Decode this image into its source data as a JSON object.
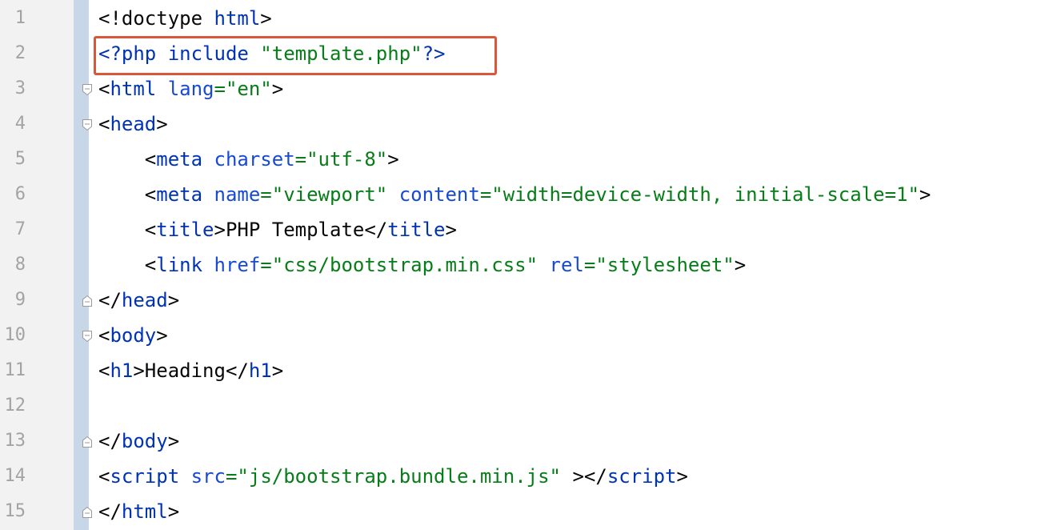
{
  "editor": {
    "highlight_color": "#d9573b",
    "colors": {
      "gutter": "#f2f2f2",
      "fold_bar": "#c8d7e8",
      "line_number": "#a3a3a3",
      "tag": "#0033b3",
      "attribute": "#174ad4",
      "string": "#067d17",
      "text": "#080808"
    },
    "lines": [
      {
        "n": "1",
        "fold": "none",
        "tokens": [
          {
            "k": "p",
            "t": "<!doctype "
          },
          {
            "k": "t",
            "t": "html"
          },
          {
            "k": "p",
            "t": ">"
          }
        ]
      },
      {
        "n": "2",
        "fold": "none",
        "tokens": [
          {
            "k": "t",
            "t": "<?php "
          },
          {
            "k": "t",
            "t": "include "
          },
          {
            "k": "v",
            "t": "\"template.php\""
          },
          {
            "k": "t",
            "t": "?>"
          }
        ]
      },
      {
        "n": "3",
        "fold": "open",
        "tokens": [
          {
            "k": "p",
            "t": "<"
          },
          {
            "k": "t",
            "t": "html "
          },
          {
            "k": "a",
            "t": "lang"
          },
          {
            "k": "v",
            "t": "=\"en\""
          },
          {
            "k": "p",
            "t": ">"
          }
        ]
      },
      {
        "n": "4",
        "fold": "open",
        "tokens": [
          {
            "k": "p",
            "t": "<"
          },
          {
            "k": "t",
            "t": "head"
          },
          {
            "k": "p",
            "t": ">"
          }
        ]
      },
      {
        "n": "5",
        "fold": "none",
        "tokens": [
          {
            "k": "p",
            "t": "    <"
          },
          {
            "k": "t",
            "t": "meta "
          },
          {
            "k": "a",
            "t": "charset"
          },
          {
            "k": "v",
            "t": "=\"utf-8\""
          },
          {
            "k": "p",
            "t": ">"
          }
        ]
      },
      {
        "n": "6",
        "fold": "none",
        "tokens": [
          {
            "k": "p",
            "t": "    <"
          },
          {
            "k": "t",
            "t": "meta "
          },
          {
            "k": "a",
            "t": "name"
          },
          {
            "k": "v",
            "t": "=\"viewport\" "
          },
          {
            "k": "a",
            "t": "content"
          },
          {
            "k": "v",
            "t": "=\"width=device-width, initial-scale=1\""
          },
          {
            "k": "p",
            "t": ">"
          }
        ]
      },
      {
        "n": "7",
        "fold": "none",
        "tokens": [
          {
            "k": "p",
            "t": "    <"
          },
          {
            "k": "t",
            "t": "title"
          },
          {
            "k": "p",
            "t": ">PHP Template</"
          },
          {
            "k": "t",
            "t": "title"
          },
          {
            "k": "p",
            "t": ">"
          }
        ]
      },
      {
        "n": "8",
        "fold": "none",
        "tokens": [
          {
            "k": "p",
            "t": "    <"
          },
          {
            "k": "t",
            "t": "link "
          },
          {
            "k": "a",
            "t": "href"
          },
          {
            "k": "v",
            "t": "=\"css/bootstrap.min.css\" "
          },
          {
            "k": "a",
            "t": "rel"
          },
          {
            "k": "v",
            "t": "=\"stylesheet\""
          },
          {
            "k": "p",
            "t": ">"
          }
        ]
      },
      {
        "n": "9",
        "fold": "close",
        "tokens": [
          {
            "k": "p",
            "t": "</"
          },
          {
            "k": "t",
            "t": "head"
          },
          {
            "k": "p",
            "t": ">"
          }
        ]
      },
      {
        "n": "10",
        "fold": "open",
        "tokens": [
          {
            "k": "p",
            "t": "<"
          },
          {
            "k": "t",
            "t": "body"
          },
          {
            "k": "p",
            "t": ">"
          }
        ]
      },
      {
        "n": "11",
        "fold": "none",
        "tokens": [
          {
            "k": "p",
            "t": "<"
          },
          {
            "k": "t",
            "t": "h1"
          },
          {
            "k": "p",
            "t": ">Heading</"
          },
          {
            "k": "t",
            "t": "h1"
          },
          {
            "k": "p",
            "t": ">"
          }
        ]
      },
      {
        "n": "12",
        "fold": "none",
        "tokens": []
      },
      {
        "n": "13",
        "fold": "close",
        "tokens": [
          {
            "k": "p",
            "t": "</"
          },
          {
            "k": "t",
            "t": "body"
          },
          {
            "k": "p",
            "t": ">"
          }
        ]
      },
      {
        "n": "14",
        "fold": "none",
        "tokens": [
          {
            "k": "p",
            "t": "<"
          },
          {
            "k": "t",
            "t": "script "
          },
          {
            "k": "a",
            "t": "src"
          },
          {
            "k": "v",
            "t": "=\"js/bootstrap.bundle.min.js\" "
          },
          {
            "k": "p",
            "t": "></"
          },
          {
            "k": "t",
            "t": "script"
          },
          {
            "k": "p",
            "t": ">"
          }
        ]
      },
      {
        "n": "15",
        "fold": "close",
        "tokens": [
          {
            "k": "p",
            "t": "</"
          },
          {
            "k": "t",
            "t": "html"
          },
          {
            "k": "p",
            "t": ">"
          }
        ]
      }
    ]
  }
}
